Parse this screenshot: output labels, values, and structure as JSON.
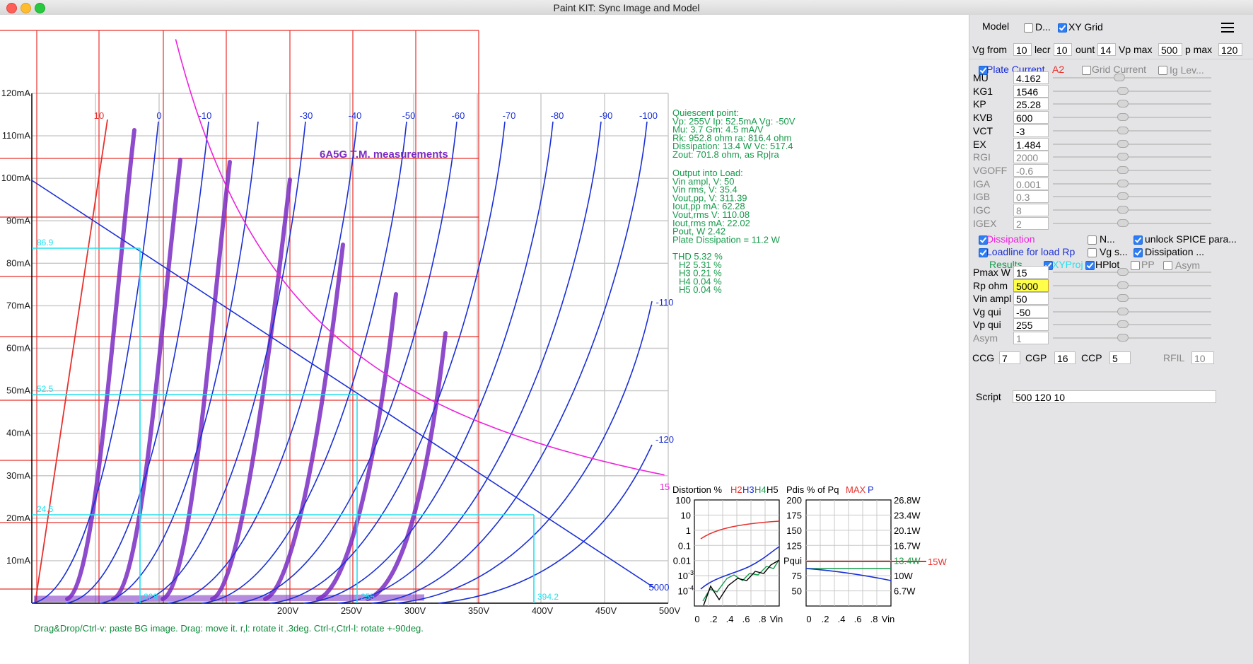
{
  "window": {
    "title": "Paint KIT: Sync Image and Model"
  },
  "plot": {
    "y_ticks": [
      "120mA",
      "110mA",
      "100mA",
      "90mA",
      "80mA",
      "70mA",
      "60mA",
      "50mA",
      "40mA",
      "30mA",
      "20mA",
      "10mA"
    ],
    "x_ticks": [
      "200V",
      "250V",
      "300V",
      "350V",
      "400V",
      "450V",
      "500V"
    ],
    "vg_labels_top": [
      "10",
      "0",
      "-10",
      "-30",
      "-40",
      "-50",
      "-60",
      "-70",
      "-80",
      "-90",
      "-100"
    ],
    "vg_labels_side": [
      "-110",
      "-120"
    ],
    "load_label": "5000",
    "pmax_label": "15",
    "image_title": "6A5G T.M. measurements",
    "cursor_y_labels": [
      "86.9",
      "52.5",
      "24.6"
    ],
    "cursor_x_labels": [
      "228",
      "255",
      "394.2"
    ],
    "colors": {
      "grid": "#c8c8c8",
      "red": "#e8302c",
      "blue": "#1a2fd6",
      "cyan": "#22e0ee",
      "magenta": "#ee22dd",
      "purple": "#7a2bc2",
      "green": "#149a4a"
    }
  },
  "results": {
    "quiescent_lines": [
      "Quiescent point:",
      "Vp: 255V  Ip: 52.5mA  Vg: -50V",
      "Mu: 3.7 Gm: 4.5 mA/V",
      "Rk: 952.8 ohm ra: 816.4 ohm",
      "Dissipation: 13.4 W Vc: 517.4",
      "Zout: 701.8 ohm, as Rp|ra"
    ],
    "output_lines": [
      "Output into Load:",
      "Vin ampl, V: 50",
      "Vin rms,  V: 35.4",
      "Vout,pp,   V: 311.39",
      "Iout,pp   mA: 62.28",
      "Vout,rms   V: 110.08",
      "Iout,rms  mA: 22.02",
      "Pout, W       2.42",
      "Plate Dissipation = 11.2 W"
    ],
    "thd_lines": [
      "THD 5.32 %",
      "  H2 5.31 %",
      "  H3 0.21 %",
      "  H4 0.04 %",
      "  H5 0.04 %"
    ]
  },
  "distortion_plot": {
    "title_prefix": "Distortion %",
    "h_labels": [
      "H2",
      "H3",
      "H4",
      "H5"
    ],
    "y_ticks": [
      "100",
      "10",
      "1",
      "0.1",
      "0.01",
      "10",
      "10"
    ],
    "y_ticks_exp": [
      "",
      "",
      "",
      "",
      "",
      "-3",
      "-4"
    ],
    "x_ticks": [
      "0",
      ".2",
      ".4",
      ".6",
      ".8"
    ],
    "x_label": "Vin"
  },
  "pdis_plot": {
    "title_prefix": "Pdis % of Pq",
    "max_label": "MAX",
    "p_label": "P",
    "y_ticks_left": [
      "200",
      "175",
      "150",
      "125",
      "Pqui",
      "75",
      "50"
    ],
    "y_ticks_right": [
      "26.8W",
      "23.4W",
      "20.1W",
      "16.7W",
      "13.4W",
      "10W",
      "6.7W"
    ],
    "x_ticks": [
      "0",
      ".2",
      ".4",
      ".6",
      ".8"
    ],
    "x_label": "Vin",
    "limit_label": "15W"
  },
  "status_bar": "Drag&Drop/Ctrl-v: paste BG image. Drag: move it. r,l: rotate it .3deg. Ctrl-r,Ctrl-l: rotate +-90deg.",
  "panel": {
    "model_label": "Model",
    "d_label": "D...",
    "xygrid_label": "XY Grid",
    "menu_icon": "hamburger-menu-icon",
    "vg_from_label": "Vg from",
    "vg_from_value": "10",
    "decr_label": "lecr",
    "decr_value": "10",
    "count_label": "ount",
    "count_value": "14",
    "vpmax_label": "Vp max",
    "vpmax_value": "500",
    "ipmax_label": "p max",
    "ipmax_value": "120",
    "plate_current_label": "Plate Current",
    "a2_label": "A2",
    "grid_current_label": "Grid Current",
    "ig_lev_label": "Ig Lev...",
    "params": [
      {
        "name": "MU",
        "value": "4.162",
        "disabled": false,
        "knob": 0.42
      },
      {
        "name": "KG1",
        "value": "1546",
        "disabled": false,
        "knob": 0.44
      },
      {
        "name": "KP",
        "value": "25.28",
        "disabled": false,
        "knob": 0.44
      },
      {
        "name": "KVB",
        "value": "600",
        "disabled": false,
        "knob": 0.44
      },
      {
        "name": "VCT",
        "value": "-3",
        "disabled": false,
        "knob": 0.44
      },
      {
        "name": "EX",
        "value": "1.484",
        "disabled": false,
        "knob": 0.44
      },
      {
        "name": "RGI",
        "value": "2000",
        "disabled": true,
        "knob": 0.44
      },
      {
        "name": "VGOFF",
        "value": "-0.6",
        "disabled": true,
        "knob": 0.44
      },
      {
        "name": "IGA",
        "value": "0.001",
        "disabled": true,
        "knob": 0.44
      },
      {
        "name": "IGB",
        "value": "0.3",
        "disabled": true,
        "knob": 0.44
      },
      {
        "name": "IGC",
        "value": "8",
        "disabled": true,
        "knob": 0.44
      },
      {
        "name": "IGEX",
        "value": "2",
        "disabled": true,
        "knob": 0.44
      }
    ],
    "dissipation_label": "Dissipation",
    "n_label": "N...",
    "unlock_label": "unlock SPICE para...",
    "loadline_label": "Loadline for load Rp",
    "vgs_label": "Vg s...",
    "dissipation2_label": "Dissipation ...",
    "results_label": "Results",
    "xyproj_label": "XYProj",
    "hplot_label": "HPlot",
    "pp_label": "PP",
    "asym_label": "Asym",
    "load_params": [
      {
        "name": "Pmax W",
        "value": "15",
        "disabled": false,
        "highlight": false,
        "knob": 0.44
      },
      {
        "name": "Rp ohm",
        "value": "5000",
        "disabled": false,
        "highlight": true,
        "knob": 0.44
      },
      {
        "name": "Vin ampl",
        "value": "50",
        "disabled": false,
        "highlight": false,
        "knob": 0.44
      },
      {
        "name": "Vg qui",
        "value": "-50",
        "disabled": false,
        "highlight": false,
        "knob": 0.44
      },
      {
        "name": "Vp qui",
        "value": "255",
        "disabled": false,
        "highlight": false,
        "knob": 0.44
      },
      {
        "name": "Asym",
        "value": "1",
        "disabled": true,
        "highlight": false,
        "knob": 0.44
      }
    ],
    "ccg_label": "CCG",
    "ccg_value": "7",
    "cgp_label": "CGP",
    "cgp_value": "16",
    "ccp_label": "CCP",
    "ccp_value": "5",
    "rfil_label": "RFIL",
    "rfil_value": "10",
    "script_label": "Script",
    "script_value": "500 120 10"
  }
}
